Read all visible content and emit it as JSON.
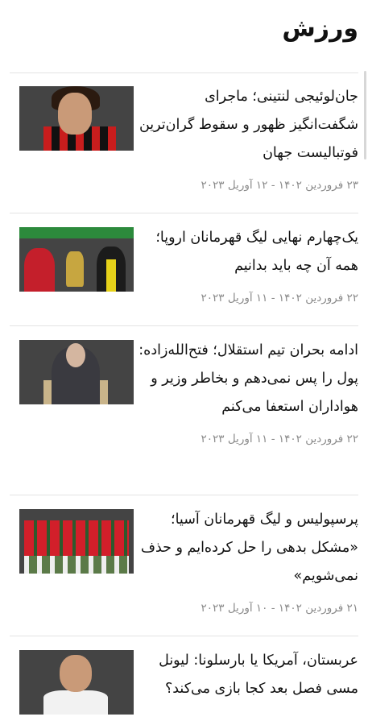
{
  "section": {
    "title": "ورزش"
  },
  "articles": [
    {
      "headline": "جان‌لوئیجی لنتینی؛ ماجرای شگفت‌انگیز ظهور و سقوط گران‌ترین فوتبالیست جهان",
      "date": "۲۳ فروردین ۱۴۰۲ - ۱۲ آوریل ۲۰۲۳"
    },
    {
      "headline": "یک‌چهارم نهایی لیگ قهرمانان اروپا؛ همه آن چه باید بدانیم",
      "date": "۲۲ فروردین ۱۴۰۲ - ۱۱ آوریل ۲۰۲۳"
    },
    {
      "headline": "ادامه بحران تیم استقلال؛ فتح‌الله‌زاده: پول را پس نمی‌دهم و بخاطر وزیر و هواداران استعفا می‌کنم",
      "date": "۲۲ فروردین ۱۴۰۲ - ۱۱ آوریل ۲۰۲۳"
    },
    {
      "headline": "پرسپولیس و لیگ قهرمانان آسیا؛ «مشکل بدهی را حل کرده‌ایم و حذف نمی‌شویم»",
      "date": "۲۱ فروردین ۱۴۰۲ - ۱۰ آوریل ۲۰۲۳"
    },
    {
      "headline": "عربستان، آمریکا یا بارسلونا: لیونل مسی فصل بعد کجا بازی می‌کند؟",
      "date": ""
    }
  ]
}
